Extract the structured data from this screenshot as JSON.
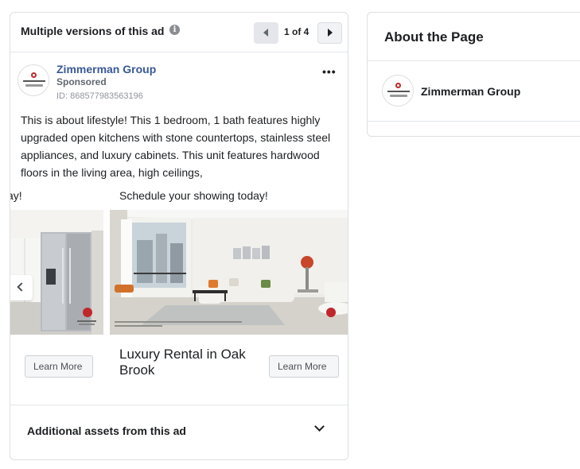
{
  "ad_card": {
    "header_title": "Multiple versions of this ad",
    "info_icon": "info-icon",
    "pager": {
      "count_label": "1 of 4"
    },
    "page_name": "Zimmerman Group",
    "sponsored_label": "Sponsored",
    "ad_id": "ID: 868577983563196",
    "more_icon_text": "•••",
    "body_text": "This is about lifestyle! This 1 bedroom, 1 bath features highly upgraded open kitchens with stone countertops, stainless steel appliances, and luxury cabinets. This unit features hardwood floors in the living area, high ceilings,",
    "carousel": {
      "slides": [
        {
          "headline": "ay!",
          "cta": "Learn More"
        },
        {
          "headline": "Schedule your showing today!",
          "title": "Luxury Rental in Oak Brook",
          "cta": "Learn More"
        }
      ]
    },
    "assets_label": "Additional assets from this ad"
  },
  "about": {
    "title": "About the Page",
    "page_name": "Zimmerman Group"
  },
  "colors": {
    "link_blue": "#385898",
    "logo_red": "#c0272d",
    "border": "#dddfe2",
    "button_bg": "#f5f6f7"
  }
}
